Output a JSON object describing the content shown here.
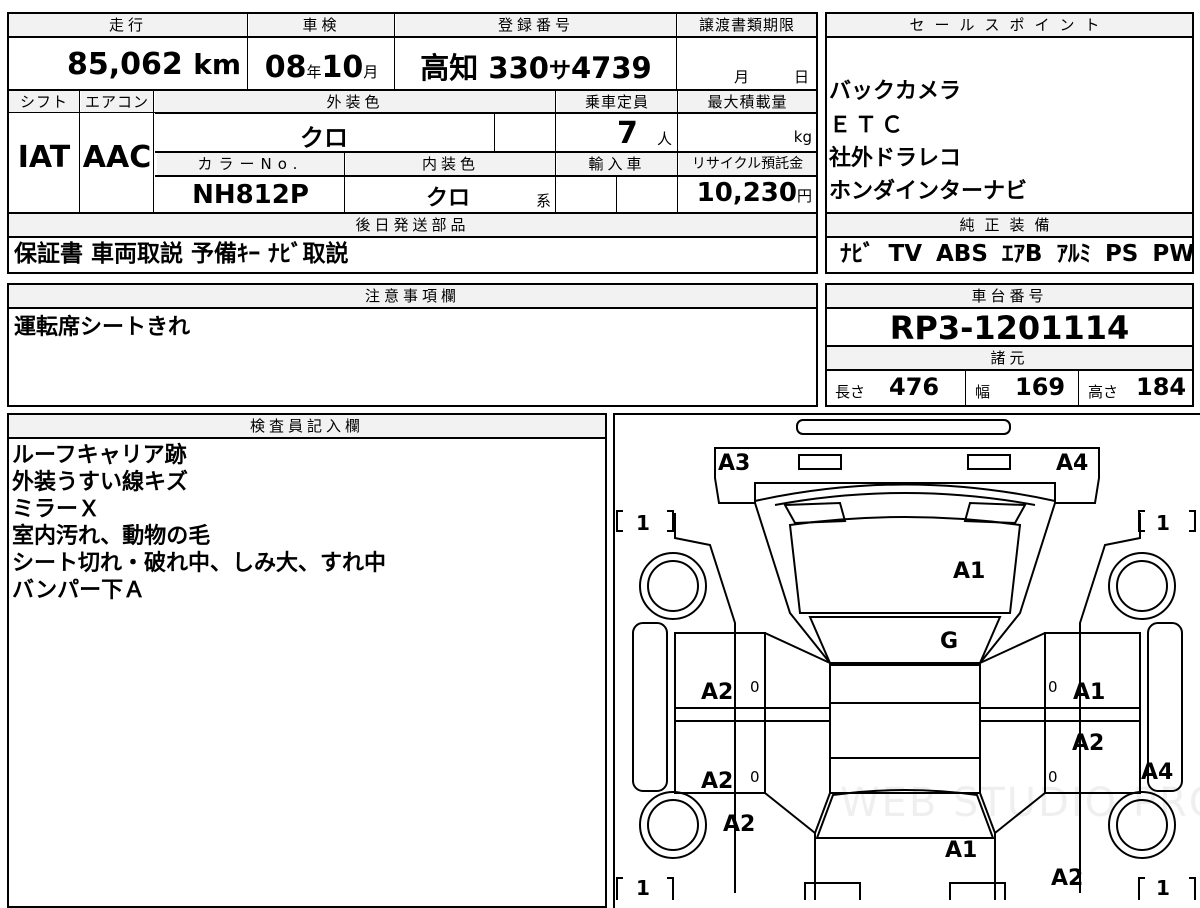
{
  "top": {
    "h_mileage": "走行",
    "h_inspection": "車検",
    "h_reg": "登録番号",
    "h_transfer": "譲渡書類期限",
    "mileage": "85,062",
    "mileage_unit": "km",
    "insp_year": "08",
    "insp_month": "10",
    "unit_year": "年",
    "unit_month": "月",
    "reg_area": "高知",
    "reg_num": "330",
    "reg_kana": "サ",
    "reg_serial": "4739",
    "transfer_month": "月",
    "transfer_day": "日",
    "h_shift": "シフト",
    "h_ac": "エアコン",
    "h_ext_color": "外装色",
    "h_capacity": "乗車定員",
    "h_maxload": "最大積載量",
    "shift": "IAT",
    "ac": "AAC",
    "ext_color": "クロ",
    "capacity": "7",
    "capacity_unit": "人",
    "maxload_unit": "kg",
    "h_color_no": "カラーNo.",
    "h_int_color": "内装色",
    "h_import": "輸入車",
    "h_recycle": "リサイクル預託金",
    "color_no": "NH812P",
    "int_color": "クロ",
    "int_color_unit": "系",
    "recycle": "10,230",
    "recycle_unit": "円",
    "h_later": "後日発送部品",
    "later_items": "保証書 車両取説 予備ｷｰ ﾅﾋﾞ取説"
  },
  "sales": {
    "header": "セールスポイント",
    "items": [
      "バックカメラ",
      "ＥＴＣ",
      "社外ドラレコ",
      "ホンダインターナビ"
    ],
    "genuine_header": "純正装備",
    "genuine": "ﾅﾋﾞ TV ABS ｴｱB ｱﾙﾐ PS PW"
  },
  "caution": {
    "header": "注意事項欄",
    "text": "運転席シートきれ"
  },
  "chassis": {
    "header": "車台番号",
    "number": "RP3-1201114",
    "spec_header": "諸元",
    "len_label": "長さ",
    "len": "476",
    "wid_label": "幅",
    "wid": "169",
    "hei_label": "高さ",
    "hei": "184"
  },
  "inspector": {
    "header": "検査員記入欄",
    "lines": [
      "ルーフキャリア跡",
      "外装うすい線キズ",
      "ミラーＸ",
      "室内汚れ、動物の毛",
      "シート切れ・破れ中、しみ大、すれ中",
      "バンパー下Ａ"
    ]
  },
  "diagram": {
    "marks": {
      "fl_corner": "A3",
      "fr_corner": "A4",
      "hood": "A1",
      "windshield": "G",
      "front_left_door": "A2",
      "front_right_door": "A1",
      "rear_left_door": "A2",
      "rear_right_door": "A2",
      "right_rear_panel": "A4",
      "left_rear_wheel": "A2",
      "rear_roof": "A1",
      "rear_right_corner": "A2",
      "tire_fl": "1",
      "tire_fr": "1",
      "tire_rl": "1",
      "tire_rr": "1",
      "door_small_fl": "0",
      "door_small_fr": "0",
      "door_small_rl": "0",
      "door_small_rr": "0"
    },
    "watermark": "WEB STUDIO PRO"
  }
}
